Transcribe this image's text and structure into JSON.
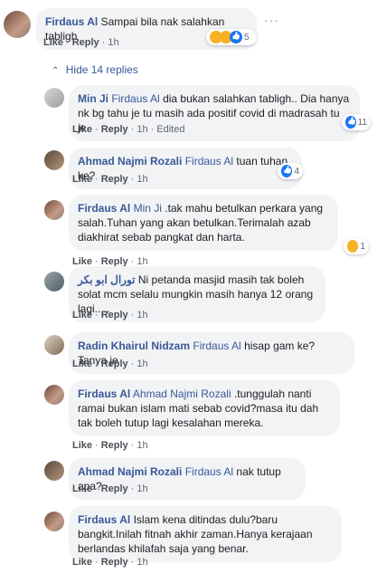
{
  "actions": {
    "like": "Like",
    "reply": "Reply",
    "edited": "Edited"
  },
  "top": {
    "author": "Firdaus Al",
    "text": "Sampai bila nak salahkan tabligh",
    "time": "1h",
    "reaction_count": "5",
    "more": "···"
  },
  "hide_replies": "Hide 14 replies",
  "replies": [
    {
      "author": "Min Ji",
      "mention": "Firdaus Al",
      "text": "dia bukan salahkan tabligh.. Dia hanya nk bg tahu je tu masih ada positif covid di madrasah tu je",
      "time": "1h",
      "reaction_count": "11"
    },
    {
      "author": "Ahmad Najmi Rozali",
      "mention": "Firdaus Al",
      "text": "tuan tuhan ke?",
      "time": "1h",
      "reaction_count": "4"
    },
    {
      "author": "Firdaus Al",
      "mention": "Min Ji",
      "text": ".tak mahu betulkan perkara yang salah.Tuhan yang akan betulkan.Terimalah azab diakhirat sebab pangkat dan harta.",
      "time": "1h",
      "reaction_count": "1"
    },
    {
      "author": "تورال ابو بكر",
      "mention": "",
      "text": "Ni petanda masjid masih tak boleh solat mcm selalu mungkin masih hanya 12 orang lagi.....",
      "time": "1h",
      "reaction_count": ""
    },
    {
      "author": "Radin Khairul Nidzam",
      "mention": "Firdaus Al",
      "text": "hisap gam ke? Tanya je",
      "time": "1h",
      "reaction_count": ""
    },
    {
      "author": "Firdaus Al",
      "mention": "Ahmad Najmi Rozali",
      "text": ".tunggulah nanti ramai bukan islam mati sebab covid?masa itu dah tak boleh tutup lagi kesalahan mereka.",
      "time": "1h",
      "reaction_count": ""
    },
    {
      "author": "Ahmad Najmi Rozali",
      "mention": "Firdaus Al",
      "text": "nak tutup apa?",
      "time": "1h",
      "reaction_count": ""
    },
    {
      "author": "Firdaus Al",
      "mention": "",
      "text": "Islam kena ditindas dulu?baru bangkit.Inilah fitnah akhir zaman.Hanya kerajaan berlandas khilafah saja yang benar.",
      "time": "1h",
      "reaction_count": ""
    }
  ],
  "colors": {
    "link": "#385898",
    "bubble": "#f2f3f5",
    "like": "#1877f2"
  }
}
